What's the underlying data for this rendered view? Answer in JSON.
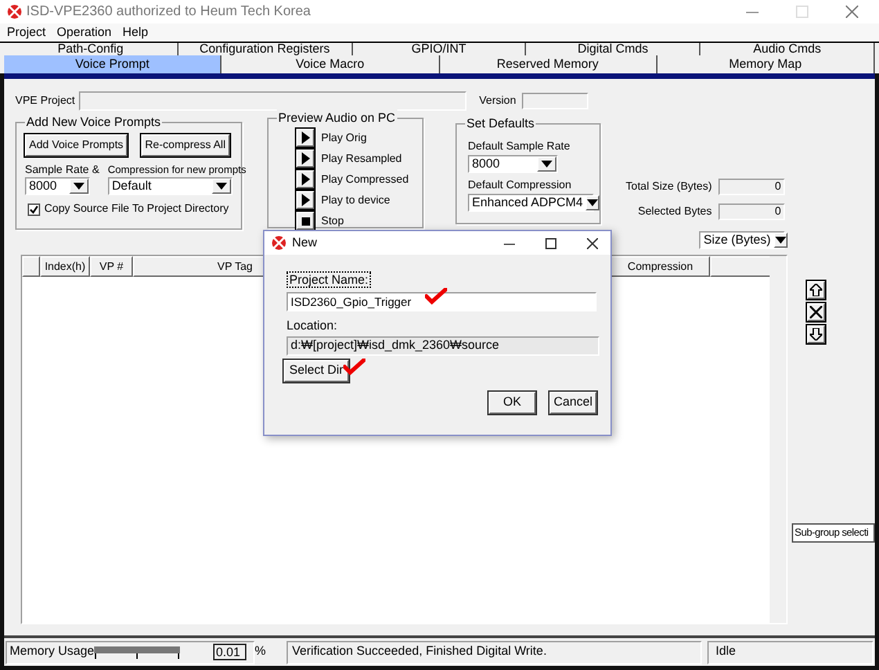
{
  "window": {
    "title": "ISD-VPE2360 authorized to Heum Tech Korea"
  },
  "menu": [
    "Project",
    "Operation",
    "Help"
  ],
  "tabs_back": [
    {
      "label": "Path-Config",
      "selected": false
    },
    {
      "label": "Configuration Registers",
      "selected": false
    },
    {
      "label": "GPIO/INT",
      "selected": false
    },
    {
      "label": "Digital Cmds",
      "selected": false
    },
    {
      "label": "Audio Cmds",
      "selected": false
    }
  ],
  "tabs": [
    {
      "label": "Voice Prompt",
      "selected": true
    },
    {
      "label": "Voice Macro",
      "selected": false
    },
    {
      "label": "Reserved Memory",
      "selected": false
    },
    {
      "label": "Memory Map",
      "selected": false
    }
  ],
  "vpe_project": {
    "label": "VPE Project"
  },
  "version": {
    "label": "Version"
  },
  "add_group": {
    "title": "Add New Voice Prompts",
    "buttons": [
      "Add Voice Prompts",
      "Re-compress All"
    ],
    "sample_rate": {
      "label": "Sample Rate &",
      "value": "8000"
    },
    "compression": {
      "label": "Compression for new prompts",
      "value": "Default"
    },
    "copy_checkbox": {
      "label": "Copy Source File To Project Directory",
      "checked": true
    }
  },
  "preview_group": {
    "title": "Preview Audio on PC",
    "actions": [
      {
        "label": "Play Orig",
        "kind": "play"
      },
      {
        "label": "Play Resampled",
        "kind": "play"
      },
      {
        "label": "Play Compressed",
        "kind": "play"
      },
      {
        "label": "Play to device",
        "kind": "play"
      },
      {
        "label": "Stop",
        "kind": "stop"
      }
    ]
  },
  "defaults_group": {
    "title": "Set Defaults",
    "sample_rate": {
      "label": "Default Sample Rate",
      "value": "8000"
    },
    "compression": {
      "label": "Default Compression",
      "value": "Enhanced ADPCM4"
    }
  },
  "totals": [
    {
      "label": "Total Size (Bytes)",
      "value": "0"
    },
    {
      "label": "Selected Bytes",
      "value": "0"
    }
  ],
  "size_unit": "Size (Bytes)",
  "table": {
    "columns": [
      "Index(h)",
      "VP #",
      "VP Tag",
      "Compression"
    ]
  },
  "subgroup_button": "Sub-group selecti",
  "dialog": {
    "title": "New",
    "project_name": {
      "label": "Project Name:",
      "value": "ISD2360_Gpio_Trigger"
    },
    "location": {
      "label": "Location:",
      "value": "d:₩[project]₩isd_dmk_2360₩source"
    },
    "select_dir": "Select Dir",
    "buttons": [
      "OK",
      "Cancel"
    ]
  },
  "status_bar": {
    "memory_label": "Memory Usage",
    "percent": "0.01",
    "percent_unit": "%",
    "message": "Verification Succeeded, Finished Digital Write.",
    "state": "Idle"
  }
}
